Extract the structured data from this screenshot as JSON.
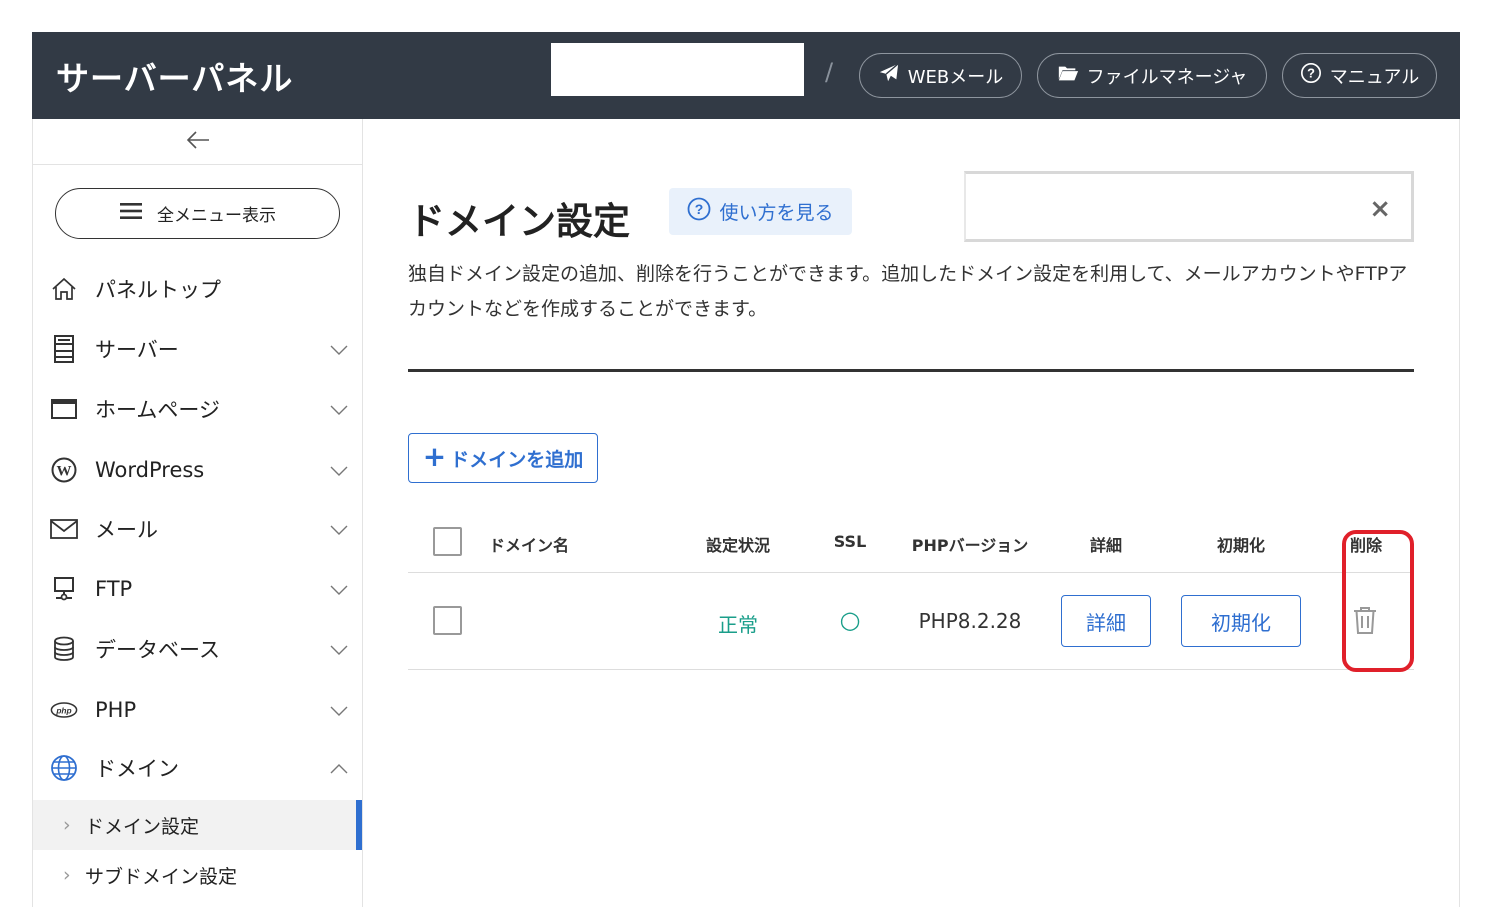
{
  "header": {
    "logo": "サーバーパネル",
    "separator": "/",
    "links": [
      {
        "label": "WEBメール",
        "icon": "paper-plane-icon"
      },
      {
        "label": "ファイルマネージャ",
        "icon": "folder-open-icon"
      },
      {
        "label": "マニュアル",
        "icon": "question-circle-icon"
      }
    ]
  },
  "sidebar": {
    "collapse_icon": "arrow-left-icon",
    "all_menu_label": "全メニュー表示",
    "items": [
      {
        "label": "パネルトップ",
        "icon": "home-icon"
      },
      {
        "label": "サーバー",
        "icon": "server-icon"
      },
      {
        "label": "ホームページ",
        "icon": "browser-window-icon"
      },
      {
        "label": "WordPress",
        "icon": "wordpress-icon"
      },
      {
        "label": "メール",
        "icon": "envelope-icon"
      },
      {
        "label": "FTP",
        "icon": "ftp-icon"
      },
      {
        "label": "データベース",
        "icon": "database-icon"
      },
      {
        "label": "PHP",
        "icon": "php-icon"
      },
      {
        "label": "ドメイン",
        "icon": "globe-icon"
      }
    ],
    "sub_items": [
      {
        "label": "ドメイン設定",
        "active": true
      },
      {
        "label": "サブドメイン設定",
        "active": false
      }
    ],
    "accent_color": "#2f6fd0"
  },
  "main": {
    "title": "ドメイン設定",
    "howto_label": "使い方を見る",
    "notice_close": "×",
    "description": "独自ドメイン設定の追加、削除を行うことができます。追加したドメイン設定を利用して、メールアカウントやFTPアカウントなどを作成することができます。",
    "add_button": {
      "plus": "+",
      "label": "ドメインを追加"
    },
    "table": {
      "headers": [
        "ドメイン名",
        "設定状況",
        "SSL",
        "PHPバージョン",
        "詳細",
        "初期化",
        "削除"
      ],
      "rows": [
        {
          "domain": "",
          "status": "正常",
          "ssl": "○",
          "php": "PHP8.2.28",
          "detail_button": "詳細",
          "reset_button": "初期化",
          "delete_icon": "trash-icon"
        }
      ]
    },
    "status_color": "#1a9e8a",
    "highlight_color": "#e0202a"
  }
}
